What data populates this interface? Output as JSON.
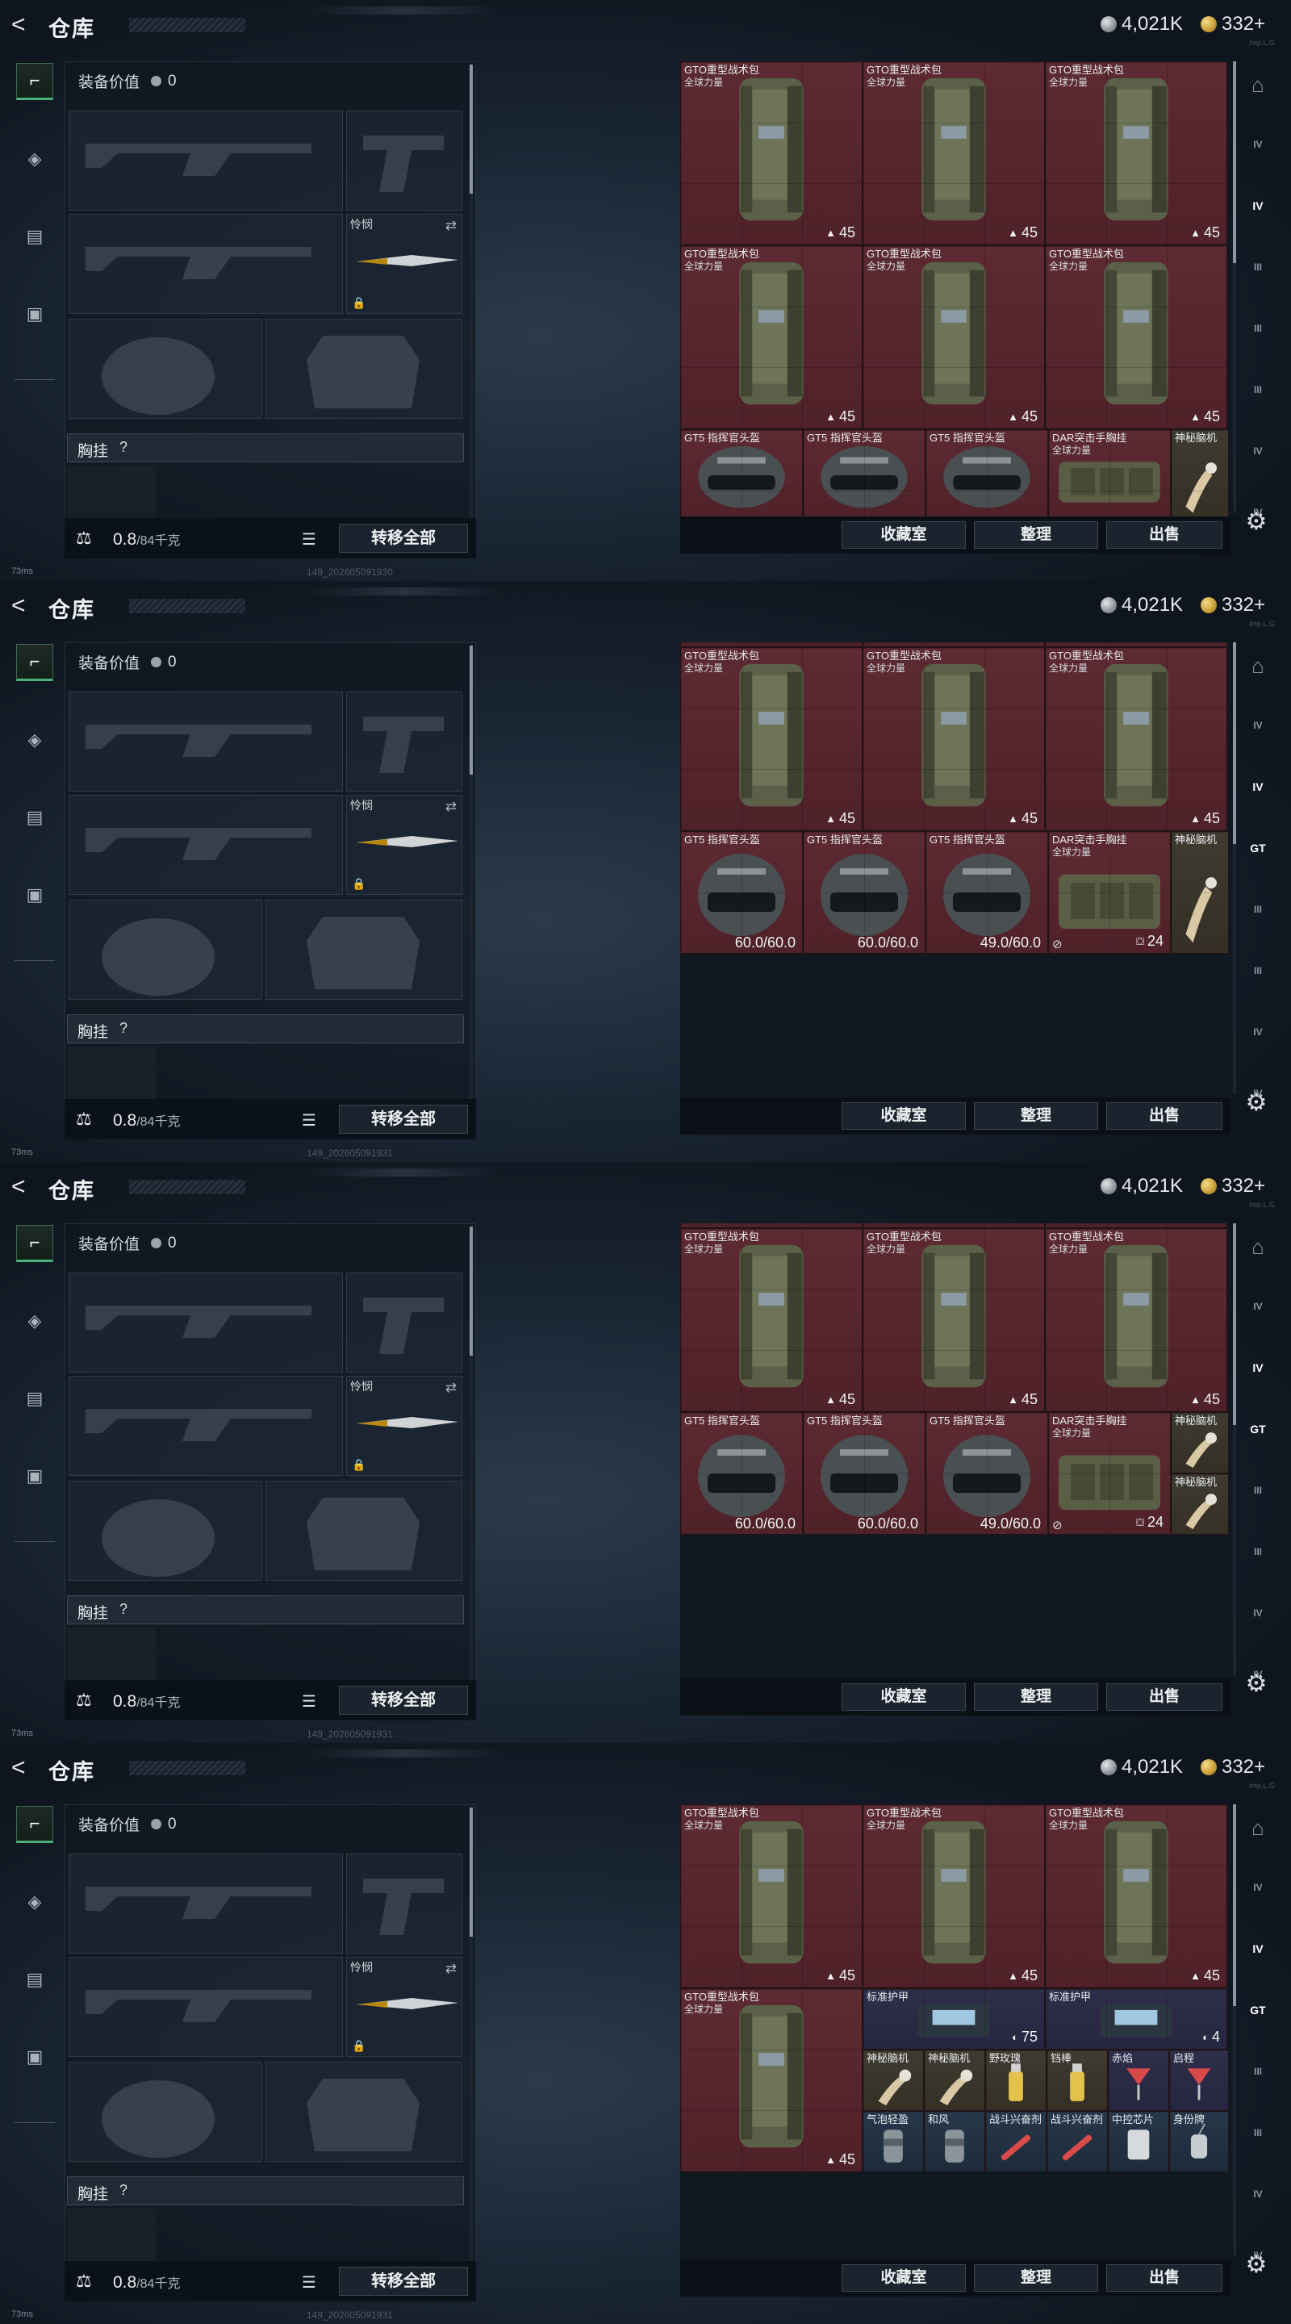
{
  "frames": [
    {
      "top_title": "仓库",
      "silver": "4,021K",
      "gold": "332+",
      "coin_sub": "Imp.L.G",
      "equip_value_label": "装备价值",
      "equip_value": "0",
      "melee_label": "怜悯",
      "rig_label": "胸挂",
      "rig_help": "?",
      "weight": "0.8",
      "weight_cap": "/84千克",
      "transfer_all": "转移全部",
      "btn_collection": "收藏室",
      "btn_sort": "整理",
      "btn_sell": "出售",
      "ping": "73ms",
      "session": "149_202605091930",
      "rail": [
        "IV",
        "IV",
        "III",
        "III",
        "III",
        "IV",
        "IV"
      ],
      "items": [
        {
          "name": "GTO重型战术包",
          "sub": "全球力量",
          "count": "45",
          "type": "backpack",
          "color": "red"
        },
        {
          "name": "GTO重型战术包",
          "sub": "全球力量",
          "count": "45",
          "type": "backpack",
          "color": "red"
        },
        {
          "name": "GTO重型战术包",
          "sub": "全球力量",
          "count": "45",
          "type": "backpack",
          "color": "red"
        },
        {
          "name": "GTO重型战术包",
          "sub": "全球力量",
          "count": "45",
          "type": "backpack",
          "color": "red"
        },
        {
          "name": "GTO重型战术包",
          "sub": "全球力量",
          "count": "45",
          "type": "backpack",
          "color": "red"
        },
        {
          "name": "GTO重型战术包",
          "sub": "全球力量",
          "count": "45",
          "type": "backpack",
          "color": "red"
        },
        {
          "name": "GT5 指挥官头盔",
          "sub": "",
          "count": "",
          "type": "helmet",
          "color": "red"
        },
        {
          "name": "GT5 指挥官头盔",
          "sub": "",
          "count": "",
          "type": "helmet",
          "color": "red"
        },
        {
          "name": "GT5 指挥官头盔",
          "sub": "",
          "count": "",
          "type": "helmet",
          "color": "red"
        },
        {
          "name": "DAR突击手胸挂",
          "sub": "全球力量",
          "count": "",
          "type": "rig",
          "color": "red"
        },
        {
          "name": "神秘脑机",
          "sub": "",
          "count": "",
          "type": "relic",
          "color": "gold"
        },
        {
          "name": "神秘脑机",
          "sub": "",
          "count": "",
          "type": "relic",
          "color": "gold"
        }
      ]
    },
    {
      "top_title": "仓库",
      "silver": "4,021K",
      "gold": "332+",
      "coin_sub": "Imp.L.G",
      "equip_value_label": "装备价值",
      "equip_value": "0",
      "melee_label": "怜悯",
      "rig_label": "胸挂",
      "rig_help": "?",
      "weight": "0.8",
      "weight_cap": "/84千克",
      "transfer_all": "转移全部",
      "btn_collection": "收藏室",
      "btn_sort": "整理",
      "btn_sell": "出售",
      "ping": "73ms",
      "session": "149_202605091931",
      "rail": [
        "IV",
        "IV",
        "GT",
        "III",
        "III",
        "IV",
        "IV"
      ],
      "items": [
        {
          "name": "",
          "sub": "",
          "count": "45",
          "type": "backpack",
          "color": "red"
        },
        {
          "name": "",
          "sub": "",
          "count": "45",
          "type": "backpack",
          "color": "red"
        },
        {
          "name": "",
          "sub": "",
          "count": "45",
          "type": "backpack",
          "color": "red"
        },
        {
          "name": "GTO重型战术包",
          "sub": "全球力量",
          "count": "45",
          "type": "backpack",
          "color": "red"
        },
        {
          "name": "GTO重型战术包",
          "sub": "全球力量",
          "count": "45",
          "type": "backpack",
          "color": "red"
        },
        {
          "name": "GTO重型战术包",
          "sub": "全球力量",
          "count": "45",
          "type": "backpack",
          "color": "red"
        },
        {
          "name": "GT5 指挥官头盔",
          "sub": "",
          "count": "",
          "durability": "60.0/60.0",
          "type": "helmet",
          "color": "red"
        },
        {
          "name": "GT5 指挥官头盔",
          "sub": "",
          "count": "",
          "durability": "60.0/60.0",
          "type": "helmet",
          "color": "red"
        },
        {
          "name": "GT5 指挥官头盔",
          "sub": "",
          "count": "",
          "durability": "49.0/60.0",
          "type": "helmet",
          "color": "red"
        },
        {
          "name": "DAR突击手胸挂",
          "sub": "全球力量",
          "count": "24",
          "type": "rig",
          "color": "red"
        },
        {
          "name": "神秘脑机",
          "sub": "",
          "count": "",
          "type": "relic",
          "color": "gold"
        }
      ]
    },
    {
      "top_title": "仓库",
      "silver": "4,021K",
      "gold": "332+",
      "coin_sub": "Imp.L.G",
      "equip_value_label": "装备价值",
      "equip_value": "0",
      "melee_label": "怜悯",
      "rig_label": "胸挂",
      "rig_help": "?",
      "weight": "0.8",
      "weight_cap": "/84千克",
      "transfer_all": "转移全部",
      "btn_collection": "收藏室",
      "btn_sort": "整理",
      "btn_sell": "出售",
      "ping": "73ms",
      "session": "149_202605091931",
      "rail": [
        "IV",
        "IV",
        "GT",
        "III",
        "III",
        "IV",
        "IV"
      ],
      "items": [
        {
          "name": "",
          "sub": "",
          "count": "45",
          "type": "backpack",
          "color": "red"
        },
        {
          "name": "",
          "sub": "",
          "count": "45",
          "type": "backpack",
          "color": "red"
        },
        {
          "name": "",
          "sub": "",
          "count": "45",
          "type": "backpack",
          "color": "red"
        },
        {
          "name": "GTO重型战术包",
          "sub": "全球力量",
          "count": "45",
          "type": "backpack",
          "color": "red"
        },
        {
          "name": "GTO重型战术包",
          "sub": "全球力量",
          "count": "45",
          "type": "backpack",
          "color": "red"
        },
        {
          "name": "GTO重型战术包",
          "sub": "全球力量",
          "count": "45",
          "type": "backpack",
          "color": "red"
        },
        {
          "name": "GT5 指挥官头盔",
          "sub": "",
          "count": "",
          "durability": "60.0/60.0",
          "type": "helmet",
          "color": "red"
        },
        {
          "name": "GT5 指挥官头盔",
          "sub": "",
          "count": "",
          "durability": "60.0/60.0",
          "type": "helmet",
          "color": "red"
        },
        {
          "name": "GT5 指挥官头盔",
          "sub": "",
          "count": "",
          "durability": "49.0/60.0",
          "type": "helmet",
          "color": "red"
        },
        {
          "name": "DAR突击手胸挂",
          "sub": "全球力量",
          "count": "24",
          "type": "rig",
          "color": "red"
        },
        {
          "name": "神秘脑机",
          "sub": "",
          "count": "",
          "type": "relic",
          "color": "gold"
        },
        {
          "name": "神秘脑机",
          "sub": "",
          "count": "",
          "type": "relic",
          "color": "gold"
        }
      ]
    },
    {
      "top_title": "仓库",
      "silver": "4,021K",
      "gold": "332+",
      "coin_sub": "Imp.L.G",
      "equip_value_label": "装备价值",
      "equip_value": "0",
      "melee_label": "怜悯",
      "rig_label": "胸挂",
      "rig_help": "?",
      "weight": "0.8",
      "weight_cap": "/84千克",
      "transfer_all": "转移全部",
      "btn_collection": "收藏室",
      "btn_sort": "整理",
      "btn_sell": "出售",
      "ping": "73ms",
      "session": "149_202605091931",
      "rail": [
        "IV",
        "IV",
        "GT",
        "III",
        "III",
        "IV",
        "IV"
      ],
      "items": [
        {
          "name": "GTO重型战术包",
          "sub": "全球力量",
          "count": "45",
          "type": "backpack",
          "color": "red"
        },
        {
          "name": "GTO重型战术包",
          "sub": "全球力量",
          "count": "45",
          "type": "backpack",
          "color": "red"
        },
        {
          "name": "GTO重型战术包",
          "sub": "全球力量",
          "count": "45",
          "type": "backpack",
          "color": "red"
        },
        {
          "name": "GTO重型战术包",
          "sub": "全球力量",
          "count": "45",
          "type": "backpack",
          "color": "red"
        },
        {
          "name": "标准护甲",
          "sub": "",
          "count": "75",
          "type": "armor",
          "color": "purple"
        },
        {
          "name": "标准护甲",
          "sub": "",
          "count": "4",
          "type": "armor",
          "color": "purple"
        },
        {
          "name": "神秘脑机",
          "sub": "",
          "count": "",
          "type": "relic",
          "color": "gold"
        },
        {
          "name": "神秘脑机",
          "sub": "",
          "count": "",
          "type": "relic",
          "color": "gold"
        },
        {
          "name": "野玫瑰",
          "sub": "",
          "count": "",
          "type": "drink",
          "color": "gold"
        },
        {
          "name": "铛棒",
          "sub": "",
          "count": "",
          "type": "drink",
          "color": "gold"
        },
        {
          "name": "赤焰",
          "sub": "",
          "count": "",
          "type": "cocktail",
          "color": "purple"
        },
        {
          "name": "启程",
          "sub": "",
          "count": "",
          "type": "cocktail",
          "color": "purple"
        },
        {
          "name": "气泡轻盈",
          "sub": "",
          "count": "",
          "type": "can",
          "color": "blue"
        },
        {
          "name": "和风",
          "sub": "",
          "count": "",
          "type": "can",
          "color": "blue"
        },
        {
          "name": "战斗兴奋剂",
          "sub": "",
          "count": "",
          "type": "syringe",
          "color": "blue"
        },
        {
          "name": "战斗兴奋剂",
          "sub": "",
          "count": "",
          "type": "syringe",
          "color": "blue"
        },
        {
          "name": "中控芯片",
          "sub": "",
          "count": "",
          "type": "card",
          "color": "blue"
        },
        {
          "name": "身份牌",
          "sub": "",
          "count": "",
          "type": "tag",
          "color": "blue"
        }
      ]
    }
  ]
}
